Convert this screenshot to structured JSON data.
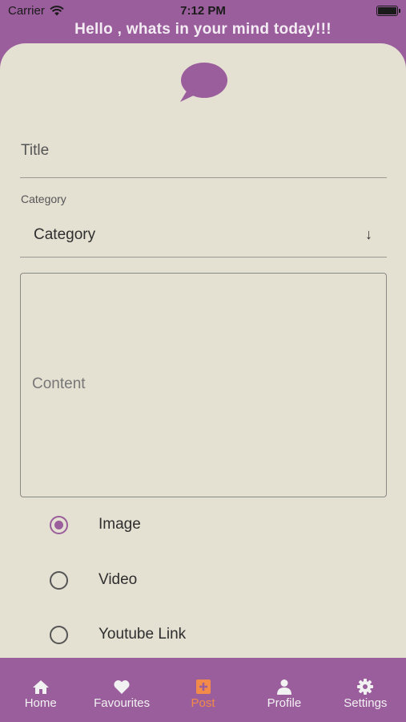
{
  "status_bar": {
    "carrier": "Carrier",
    "time": "7:12 PM"
  },
  "header": {
    "greeting": "Hello , whats in your mind today!!!"
  },
  "form": {
    "title_placeholder": "Title",
    "category_label": "Category",
    "category_value": "Category",
    "category_arrow": "↓",
    "content_placeholder": "Content",
    "media_options": [
      {
        "label": "Image",
        "selected": true
      },
      {
        "label": "Video",
        "selected": false
      },
      {
        "label": "Youtube Link",
        "selected": false
      }
    ]
  },
  "tabs": [
    {
      "label": "Home",
      "icon": "home-icon"
    },
    {
      "label": "Favourites",
      "icon": "heart-icon"
    },
    {
      "label": "Post",
      "icon": "add-post-icon",
      "active": true
    },
    {
      "label": "Profile",
      "icon": "person-icon"
    },
    {
      "label": "Settings",
      "icon": "gear-icon"
    }
  ],
  "colors": {
    "brand": "#9b5e9c",
    "card": "#e4e0d2",
    "active_tab": "#f28a4a"
  }
}
